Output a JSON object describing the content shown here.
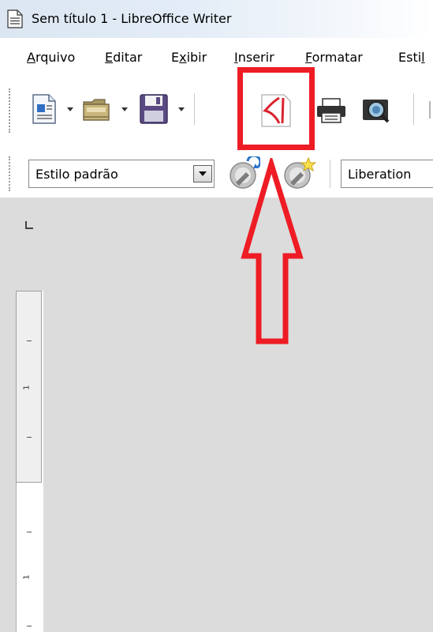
{
  "window": {
    "title": "Sem título 1 - LibreOffice Writer"
  },
  "menu": {
    "items": [
      {
        "label": "Arquivo",
        "mnemonic": "A",
        "rest": "rquivo"
      },
      {
        "label": "Editar",
        "mnemonic": "E",
        "rest": "ditar"
      },
      {
        "label": "Exibir",
        "pre": "E",
        "mnemonic": "x",
        "rest": "ibir"
      },
      {
        "label": "Inserir",
        "mnemonic": "I",
        "rest": "nserir"
      },
      {
        "label": "Formatar",
        "mnemonic": "F",
        "rest": "ormatar"
      },
      {
        "label": "Estilos",
        "pre": "Esti",
        "mnemonic": "l",
        "rest": ""
      }
    ]
  },
  "toolbar": {
    "buttons": [
      {
        "name": "new-document",
        "icon": "new-document-icon"
      },
      {
        "name": "open",
        "icon": "folder-icon"
      },
      {
        "name": "save",
        "icon": "floppy-disk-icon"
      },
      {
        "name": "export-pdf",
        "icon": "pdf-icon",
        "highlighted": true
      },
      {
        "name": "print",
        "icon": "printer-icon"
      },
      {
        "name": "print-preview",
        "icon": "print-preview-icon"
      }
    ]
  },
  "formatting": {
    "paragraph_style": "Estilo padrão",
    "font_name": "Liberation",
    "buttons": [
      {
        "name": "update-style",
        "icon": "update-style-icon"
      },
      {
        "name": "new-style",
        "icon": "new-style-icon"
      }
    ]
  },
  "ruler": {
    "labels": [
      "1",
      "1"
    ]
  },
  "annotation": {
    "color": "#ee1c24"
  }
}
